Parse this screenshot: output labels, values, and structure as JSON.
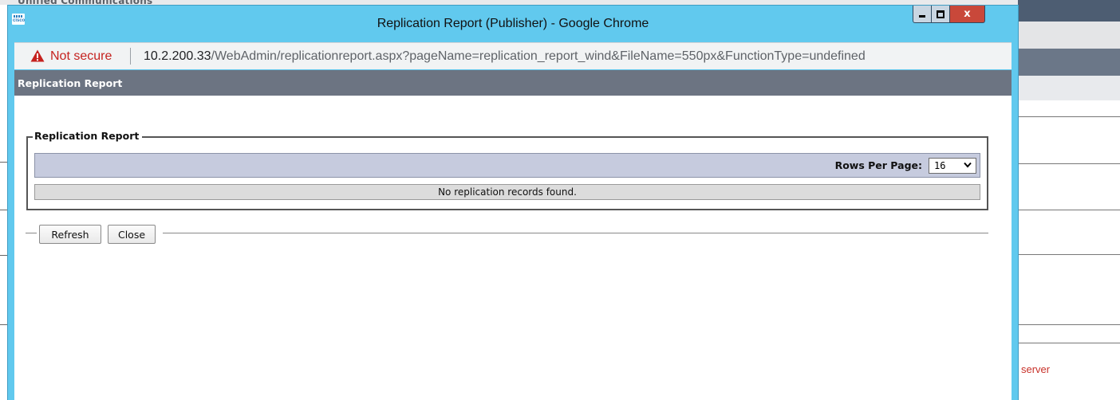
{
  "background": {
    "top_text": "Unified Communications",
    "server_text": "server"
  },
  "window": {
    "title": "Replication Report (Publisher) - Google Chrome",
    "close_glyph": "x"
  },
  "address_bar": {
    "security_label": "Not secure",
    "url_host": "10.2.200.33",
    "url_path": "/WebAdmin/replicationreport.aspx?pageName=replication_report_wind&FileName=550px&FunctionType=undefined"
  },
  "page": {
    "header_title": "Replication Report",
    "fieldset_legend": "Replication Report",
    "rows_per_page_label": "Rows Per Page:",
    "rows_per_page_value": "16",
    "empty_message": "No replication records found.",
    "refresh_label": "Refresh",
    "close_label": "Close"
  },
  "colors": {
    "titlebar": "#61c9ee",
    "page_header": "#6c7482",
    "rows_bar": "#c6cbde",
    "not_secure": "#c5221f",
    "close_button": "#c9483a"
  }
}
